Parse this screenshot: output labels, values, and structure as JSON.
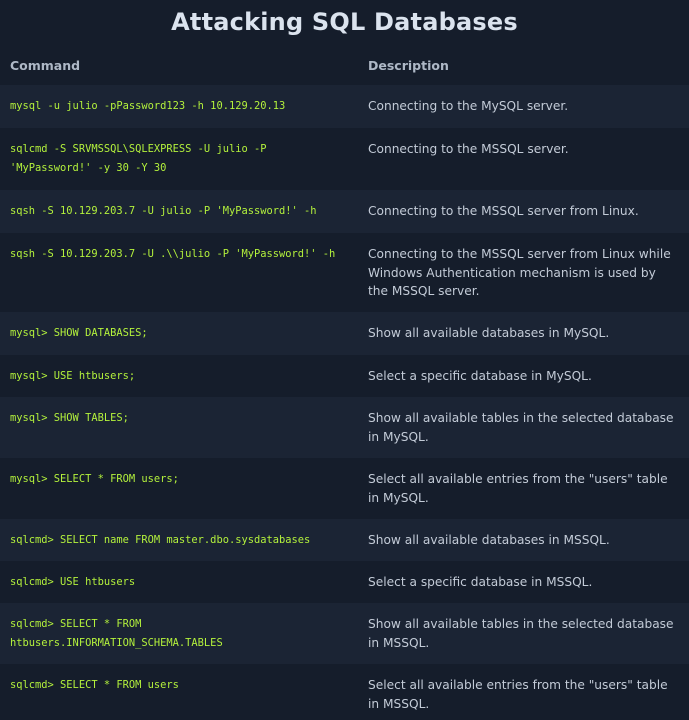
{
  "title": "Attacking SQL Databases",
  "headers": {
    "command": "Command",
    "description": "Description"
  },
  "rows": [
    {
      "command": "mysql -u julio -pPassword123 -h 10.129.20.13",
      "description": "Connecting to the MySQL server."
    },
    {
      "command": "sqlcmd -S SRVMSSQL\\SQLEXPRESS -U julio -P 'MyPassword!' -y 30 -Y 30",
      "description": "Connecting to the MSSQL server."
    },
    {
      "command": "sqsh -S 10.129.203.7 -U julio -P 'MyPassword!' -h",
      "description": "Connecting to the MSSQL server from Linux."
    },
    {
      "command": "sqsh -S 10.129.203.7 -U .\\\\julio -P 'MyPassword!' -h",
      "description": "Connecting to the MSSQL server from Linux while Windows Authentication mechanism is used by the MSSQL server."
    },
    {
      "command": "mysql> SHOW DATABASES;",
      "description": "Show all available databases in MySQL."
    },
    {
      "command": "mysql> USE htbusers;",
      "description": "Select a specific database in MySQL."
    },
    {
      "command": "mysql> SHOW TABLES;",
      "description": "Show all available tables in the selected database in MySQL."
    },
    {
      "command": "mysql> SELECT * FROM users;",
      "description": "Select all available entries from the \"users\" table in MySQL."
    },
    {
      "command": "sqlcmd> SELECT name FROM master.dbo.sysdatabases",
      "description": "Show all available databases in MSSQL."
    },
    {
      "command": "sqlcmd> USE htbusers",
      "description": "Select a specific database in MSSQL."
    },
    {
      "command": "sqlcmd> SELECT * FROM htbusers.INFORMATION_SCHEMA.TABLES",
      "description": "Show all available tables in the selected database in MSSQL."
    },
    {
      "command": "sqlcmd> SELECT * FROM users",
      "description": "Select all available entries from the \"users\" table in MSSQL."
    }
  ]
}
